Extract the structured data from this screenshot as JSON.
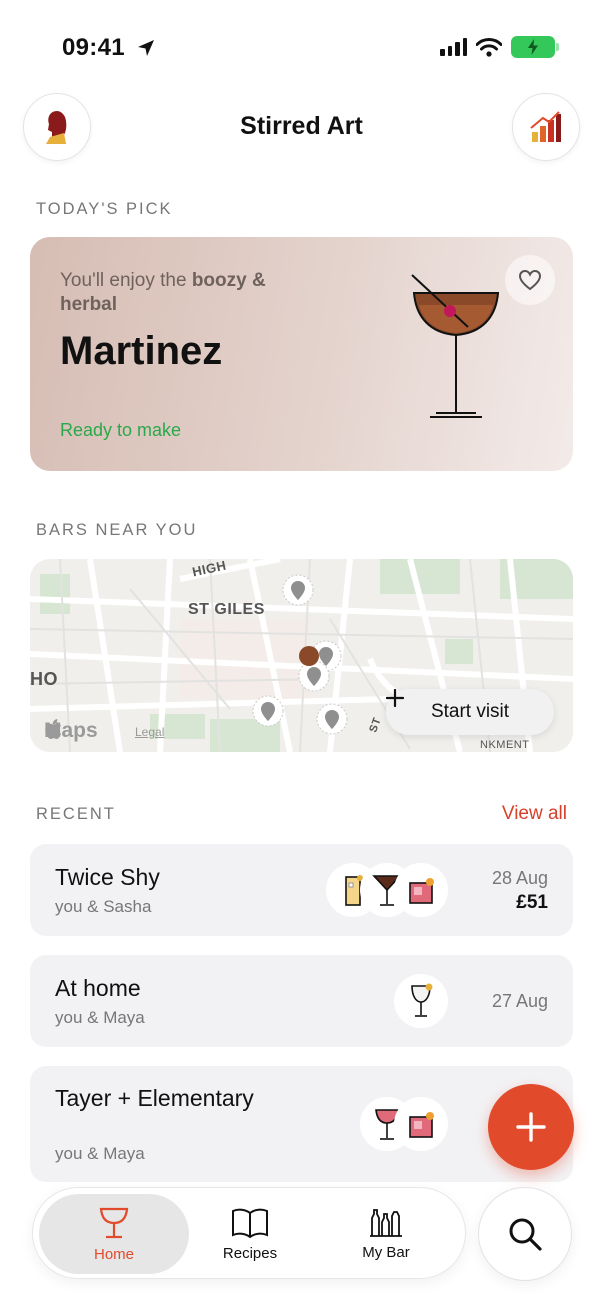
{
  "status_bar": {
    "time": "09:41"
  },
  "header": {
    "title": "Stirred Art"
  },
  "todays_pick": {
    "section_label": "TODAY'S PICK",
    "intro": "You'll enjoy the ",
    "flavor": "boozy & herbal",
    "name": "Martinez",
    "status": "Ready to make"
  },
  "bars_near_you": {
    "section_label": "BARS NEAR YOU",
    "map_labels": {
      "area": "ST GILES",
      "road_top": "HIGH",
      "edge_left": "HO",
      "road_bottom": "ST",
      "embankment": "NKMENT"
    },
    "maps_brand": "Maps",
    "legal_link": "Legal",
    "start_visit_label": "Start visit"
  },
  "recent": {
    "section_label": "RECENT",
    "view_all_label": "View all",
    "items": [
      {
        "title": "Twice Shy",
        "subtitle": "you & Sasha",
        "date": "28 Aug",
        "price": "£51"
      },
      {
        "title": "At home",
        "subtitle": "you & Maya",
        "date": "27 Aug",
        "price": ""
      },
      {
        "title": "Tayer + Elementary",
        "subtitle": "you & Maya",
        "date": "",
        "price": ""
      }
    ]
  },
  "tabbar": {
    "tabs": [
      {
        "label": "Home",
        "icon": "coupe-glass-icon",
        "active": true
      },
      {
        "label": "Recipes",
        "icon": "book-icon",
        "active": false
      },
      {
        "label": "My Bar",
        "icon": "bottles-icon",
        "active": false
      }
    ]
  },
  "colors": {
    "accent": "#e24a2c",
    "ready_green": "#2ba84a",
    "battery_green": "#34c759"
  }
}
